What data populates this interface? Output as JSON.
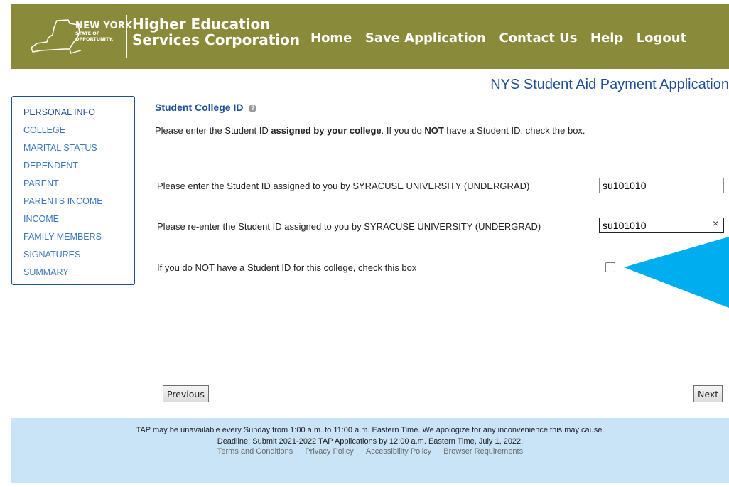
{
  "header": {
    "logo": {
      "line1": "NEW YORK",
      "line2": "STATE OF",
      "line3": "OPPORTUNITY."
    },
    "org_line1": "Higher Education",
    "org_line2": "Services Corporation",
    "nav": [
      "Home",
      "Save Application",
      "Contact Us",
      "Help",
      "Logout"
    ]
  },
  "app_title": "NYS Student Aid Payment Application",
  "sidebar": {
    "items": [
      "PERSONAL INFO",
      "COLLEGE",
      "MARITAL STATUS",
      "DEPENDENT",
      "PARENT",
      "PARENTS INCOME",
      "INCOME",
      "FAMILY MEMBERS",
      "SIGNATURES",
      "SUMMARY"
    ]
  },
  "main": {
    "section_title": "Student College ID",
    "help_icon": "question-circle-icon",
    "intro_part1": "Please enter the Student ID ",
    "intro_bold1": "assigned by your college",
    "intro_part2": ". If you do ",
    "intro_bold2": "NOT",
    "intro_part3": " have a Student ID, check the box.",
    "student_id_label": "Please enter the Student ID assigned to you by SYRACUSE UNIVERSITY (UNDERGRAD)",
    "student_id_value": "su101010",
    "reenter_label": "Please re-enter the Student ID assigned to you by SYRACUSE UNIVERSITY (UNDERGRAD)",
    "reenter_value": "su101010",
    "clear_icon": "×",
    "no_id_label": "If you do NOT have a Student ID for this college, check this box",
    "no_id_checked": false
  },
  "buttons": {
    "previous": "Previous",
    "next": "Next"
  },
  "footer": {
    "notice": "TAP may be unavailable every Sunday from 1:00 a.m. to 11:00 a.m. Eastern Time. We apologize for any inconvenience this may cause.",
    "deadline": "Deadline: Submit 2021-2022 TAP Applications by 12:00 a.m. Eastern Time, July 1, 2022.",
    "links": [
      "Terms and Conditions",
      "Privacy Policy",
      "Accessibility Policy",
      "Browser Requirements"
    ]
  },
  "colors": {
    "header_bg": "#8a8a3b",
    "brand_blue": "#1f4f9b",
    "footer_bg": "#c9e4f7",
    "callout": "#00aeef"
  }
}
